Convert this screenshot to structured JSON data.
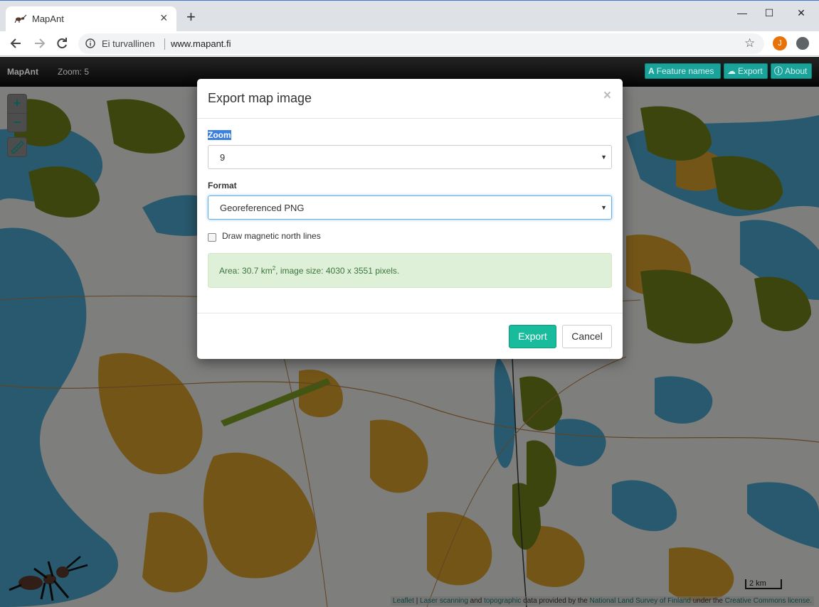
{
  "browser": {
    "tab_title": "MapAnt",
    "new_tab_label": "+",
    "security_label": "Ei turvallinen",
    "url": "www.mapant.fi",
    "profile_initial": "J",
    "window_controls": {
      "minimize": "—",
      "maximize": "☐",
      "close": "✕"
    }
  },
  "navbar": {
    "brand": "MapAnt",
    "zoom_label": "Zoom: 5",
    "buttons": [
      {
        "label": "Feature names",
        "icon": "font-icon"
      },
      {
        "label": "Export",
        "icon": "cloud-download-icon"
      },
      {
        "label": "About",
        "icon": "info-icon"
      }
    ]
  },
  "map": {
    "zoom_in": "+",
    "zoom_out": "−",
    "scale_label": "2 km",
    "attribution": {
      "leaflet": "Leaflet",
      "sep": " | ",
      "laser": "Laser scanning",
      "and": " and ",
      "topographic": "topographic",
      "provided": " data provided by the ",
      "nls": "National Land Survey of Finland",
      "under": " under the ",
      "cc": "Creative Commons license."
    }
  },
  "modal": {
    "title": "Export map image",
    "close": "×",
    "zoom_label": "Zoom",
    "zoom_value": "9",
    "format_label": "Format",
    "format_value": "Georeferenced PNG",
    "magnetic_label": "Draw magnetic north lines",
    "magnetic_checked": false,
    "info": {
      "area_prefix": "Area: 30.7 km",
      "area_sup": "2",
      "image_size": ", image size: 4030 x 3551 pixels."
    },
    "export_button": "Export",
    "cancel_button": "Cancel"
  },
  "colors": {
    "accent": "#18bc9c",
    "navbar_button": "#1aa39a",
    "water": "#4aa3c8",
    "open_land": "#d39b2c",
    "forest": "#e2e2e2",
    "urban": "#6f7f1a"
  }
}
